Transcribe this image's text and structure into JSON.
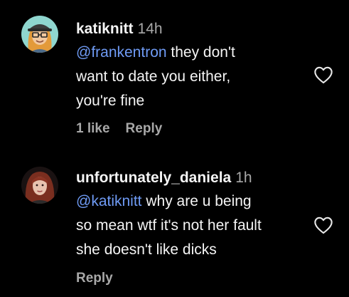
{
  "comments": [
    {
      "username": "katiknitt",
      "time": "14h",
      "mention": "@frankentron",
      "text_line1_rest": " they don't",
      "text_line2": "want to date you either,",
      "text_line3": "you're fine",
      "likes": "1 like",
      "reply": "Reply",
      "avatar_icon": "cartoon-avatar-glasses",
      "like_icon": "heart-outline-icon"
    },
    {
      "username": "unfortunately_daniela",
      "time": "1h",
      "mention": "@katiknitt",
      "text_line1_rest": " why are u being",
      "text_line2": "so mean wtf it's not her fault",
      "text_line3": "she doesn't like dicks",
      "reply": "Reply",
      "avatar_icon": "photo-avatar-red-hair",
      "like_icon": "heart-outline-icon"
    }
  ],
  "colors": {
    "background": "#000000",
    "text": "#f5f5f5",
    "muted": "#a8a8a8",
    "mention": "#6f9bf5"
  }
}
